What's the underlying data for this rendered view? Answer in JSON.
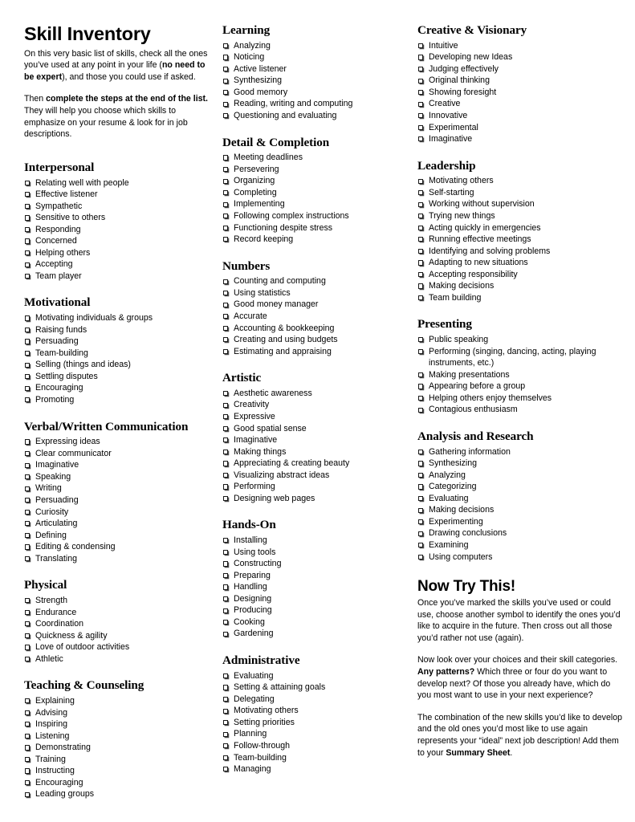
{
  "document": {
    "title": "Skill Inventory",
    "intro_paragraphs": [
      {
        "parts": [
          {
            "text": "On this very basic list of skills, check all the ones you’ve used at any point in your life (",
            "bold": false
          },
          {
            "text": "no need to be expert",
            "bold": true
          },
          {
            "text": "), and those you could use if asked.",
            "bold": false
          }
        ]
      },
      {
        "parts": [
          {
            "text": "Then ",
            "bold": false
          },
          {
            "text": "complete the steps at the end of the list.",
            "bold": true
          },
          {
            "text": " They will help you choose which skills to emphasize on your resume & look for in job descriptions.",
            "bold": false
          }
        ]
      }
    ]
  },
  "columns": [
    {
      "id": "column-1",
      "sections": [
        {
          "title": "Interpersonal",
          "items": [
            "Relating well with people",
            "Effective listener",
            "Sympathetic",
            "Sensitive to others",
            "Responding",
            "Concerned",
            "Helping others",
            "Accepting",
            "Team player"
          ]
        },
        {
          "title": "Motivational",
          "items": [
            "Motivating individuals & groups",
            "Raising funds",
            "Persuading",
            "Team-building",
            "Selling (things and ideas)",
            "Settling disputes",
            "Encouraging",
            "Promoting"
          ]
        },
        {
          "title": "Verbal/Written Communication",
          "items": [
            "Expressing ideas",
            "Clear communicator",
            "Imaginative",
            "Speaking",
            "Writing",
            "Persuading",
            "Curiosity",
            "Articulating",
            "Defining",
            "Editing & condensing",
            "Translating"
          ]
        },
        {
          "title": "Physical",
          "items": [
            "Strength",
            "Endurance",
            "Coordination",
            "Quickness & agility",
            "Love of outdoor activities",
            "Athletic"
          ]
        },
        {
          "title": "Teaching & Counseling",
          "items": [
            "Explaining",
            "Advising",
            "Inspiring",
            "Listening",
            "Demonstrating",
            "Training",
            "Instructing",
            "Encouraging",
            "Leading groups"
          ]
        }
      ]
    },
    {
      "id": "column-2",
      "sections": [
        {
          "title": "Learning",
          "items": [
            "Analyzing",
            "Noticing",
            "Active listener",
            "Synthesizing",
            "Good memory",
            "Reading, writing and computing",
            "Questioning and evaluating"
          ]
        },
        {
          "title": "Detail & Completion",
          "items": [
            "Meeting deadlines",
            "Persevering",
            "Organizing",
            "Completing",
            "Implementing",
            "Following complex instructions",
            "Functioning despite stress",
            "Record keeping"
          ]
        },
        {
          "title": "Numbers",
          "items": [
            "Counting and computing",
            "Using statistics",
            "Good money manager",
            "Accurate",
            "Accounting & bookkeeping",
            "Creating and using budgets",
            "Estimating and appraising"
          ]
        },
        {
          "title": "Artistic",
          "items": [
            "Aesthetic awareness",
            "Creativity",
            "Expressive",
            "Good spatial sense",
            "Imaginative",
            "Making things",
            "Appreciating & creating beauty",
            "Visualizing abstract ideas",
            "Performing",
            "Designing web pages"
          ]
        },
        {
          "title": "Hands-On",
          "items": [
            "Installing",
            "Using tools",
            "Constructing",
            "Preparing",
            "Handling",
            "Designing",
            "Producing",
            "Cooking",
            "Gardening"
          ]
        },
        {
          "title": "Administrative",
          "items": [
            "Evaluating",
            "Setting & attaining goals",
            "Delegating",
            "Motivating others",
            "Setting priorities",
            "Planning",
            "Follow-through",
            "Team-building",
            "Managing"
          ]
        }
      ]
    },
    {
      "id": "column-3",
      "sections": [
        {
          "title": "Creative & Visionary",
          "items": [
            "Intuitive",
            "Developing new Ideas",
            "Judging effectively",
            "Original thinking",
            "Showing foresight",
            "Creative",
            "Innovative",
            "Experimental",
            "Imaginative"
          ]
        },
        {
          "title": "Leadership",
          "items": [
            "Motivating others",
            "Self-starting",
            "Working without supervision",
            "Trying new things",
            "Acting quickly in emergencies",
            "Running effective meetings",
            "Identifying and solving problems",
            "Adapting to new situations",
            "Accepting responsibility",
            "Making decisions",
            "Team building"
          ]
        },
        {
          "title": "Presenting",
          "items": [
            "Public speaking",
            "Performing (singing, dancing, acting, playing instruments, etc.)",
            "Making presentations",
            "Appearing before a group",
            "Helping others enjoy themselves",
            "Contagious enthusiasm"
          ]
        },
        {
          "title": "Analysis and Research",
          "items": [
            "Gathering information",
            "Synthesizing",
            "Analyzing",
            "Categorizing",
            "Evaluating",
            "Making decisions",
            "Experimenting",
            "Drawing conclusions",
            "Examining",
            "Using computers"
          ]
        }
      ]
    }
  ],
  "closing": {
    "title": "Now Try This!",
    "paragraphs": [
      {
        "parts": [
          {
            "text": "Once you’ve marked the skills you’ve used or could use, choose another symbol to identify the ones you’d like to acquire in the future. Then cross out all those you’d rather not use (again).",
            "bold": false
          }
        ]
      },
      {
        "parts": [
          {
            "text": "Now look over your choices and their skill categories. ",
            "bold": false
          },
          {
            "text": "Any patterns?",
            "bold": true
          },
          {
            "text": " Which three or four do you want to develop next? Of those you already have, which do you most want to use in your next experience?",
            "bold": false
          }
        ]
      },
      {
        "parts": [
          {
            "text": "The combination of the new skills you’d like to develop and the old ones you’d most like to use again represents your “ideal” next  job description! Add them to your ",
            "bold": false
          },
          {
            "text": "Summary Sheet",
            "bold": true
          },
          {
            "text": ".",
            "bold": false
          }
        ]
      }
    ]
  },
  "icons": {
    "checkbox": "checkbox-square-icon"
  }
}
